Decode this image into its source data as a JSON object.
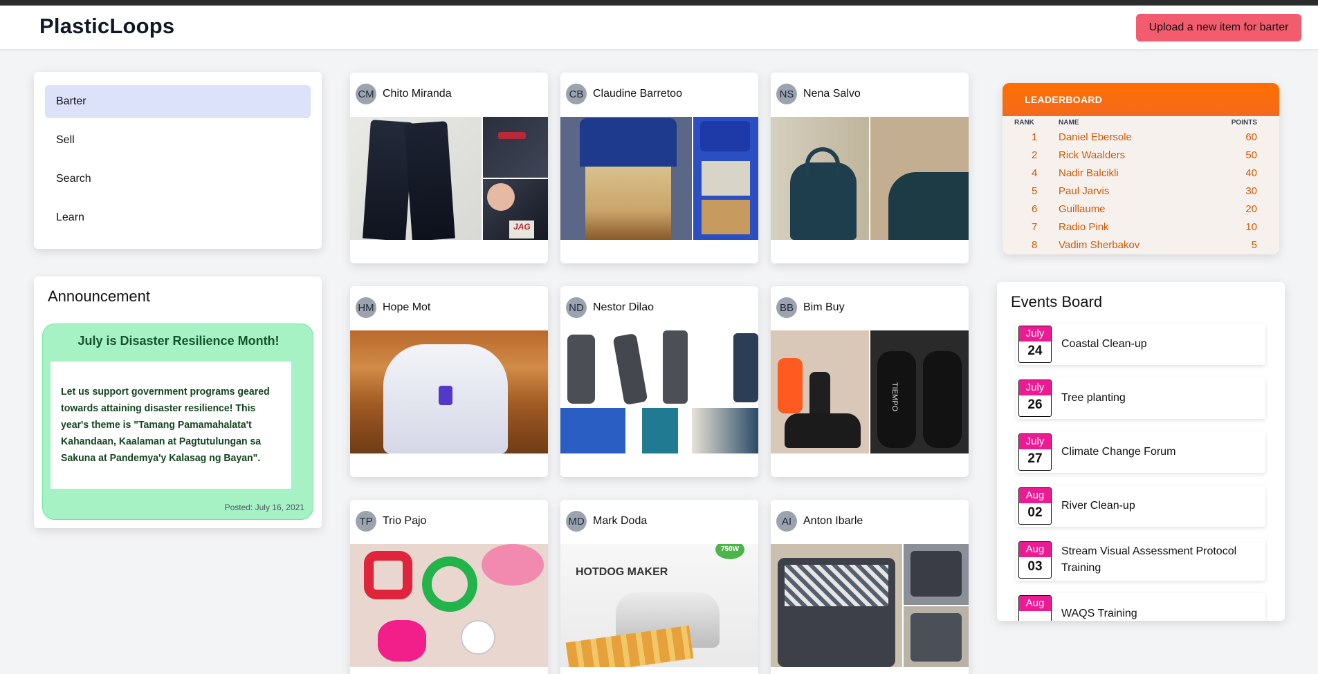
{
  "app": {
    "title": "PlasticLoops",
    "upload_label": "Upload a new item for barter"
  },
  "nav": {
    "items": [
      "Barter",
      "Sell",
      "Search",
      "Learn"
    ],
    "active": "Barter"
  },
  "announcement": {
    "title": "Announcement",
    "headline": "July is Disaster Resilience Month!",
    "body": "Let us support government programs geared towards attaining disaster resilience! This year's theme is \"Tamang Pamamahalata't Kahandaan, Kaalaman at Pagtutulungan sa Sakuna at Pandemya'y Kalasag ng Bayan\".",
    "posted": "Posted: July 16, 2021"
  },
  "items": [
    {
      "initials": "CM",
      "name": "Chito Miranda"
    },
    {
      "initials": "CB",
      "name": "Claudine Barretoo"
    },
    {
      "initials": "NS",
      "name": "Nena Salvo"
    },
    {
      "initials": "HM",
      "name": "Hope Mot"
    },
    {
      "initials": "ND",
      "name": "Nestor Dilao"
    },
    {
      "initials": "BB",
      "name": "Bim Buy"
    },
    {
      "initials": "TP",
      "name": "Trio Pajo"
    },
    {
      "initials": "MD",
      "name": "Mark Doda"
    },
    {
      "initials": "AI",
      "name": "Anton Ibarle"
    }
  ],
  "photo_text": {
    "hotdog_brand": "HOTDOG MAKER",
    "watt": "750W",
    "tiempo": "TIEMPO",
    "jag": "JAG"
  },
  "leaderboard": {
    "title": "LEADERBOARD",
    "columns": {
      "rank": "RANK",
      "name": "NAME",
      "points": "POINTS"
    },
    "rows": [
      {
        "rank": "1",
        "name": "Daniel Ebersole",
        "points": "60"
      },
      {
        "rank": "2",
        "name": "Rick Waalders",
        "points": "50"
      },
      {
        "rank": "4",
        "name": "Nadir Balcikli",
        "points": "40"
      },
      {
        "rank": "5",
        "name": "Paul Jarvis",
        "points": "30"
      },
      {
        "rank": "6",
        "name": "Guillaume",
        "points": "20"
      },
      {
        "rank": "7",
        "name": "Radio Pink",
        "points": "10"
      },
      {
        "rank": "8",
        "name": "Vadim Sherbakov",
        "points": "5"
      }
    ]
  },
  "events": {
    "title": "Events Board",
    "items": [
      {
        "month": "July",
        "day": "24",
        "name": "Coastal Clean-up"
      },
      {
        "month": "July",
        "day": "26",
        "name": "Tree planting"
      },
      {
        "month": "July",
        "day": "27",
        "name": "Climate Change Forum"
      },
      {
        "month": "Aug",
        "day": "02",
        "name": "River Clean-up"
      },
      {
        "month": "Aug",
        "day": "03",
        "name": "Stream Visual Assessment Protocol Training"
      },
      {
        "month": "Aug",
        "day": "",
        "name": "WAQS Training"
      }
    ]
  },
  "colors": {
    "accent": "#f25c6e",
    "nav_active": "#dde2fb",
    "leader_orange": "#ff6f00",
    "event_pink": "#ec1a93",
    "announce_green": "#a6f2c4"
  }
}
